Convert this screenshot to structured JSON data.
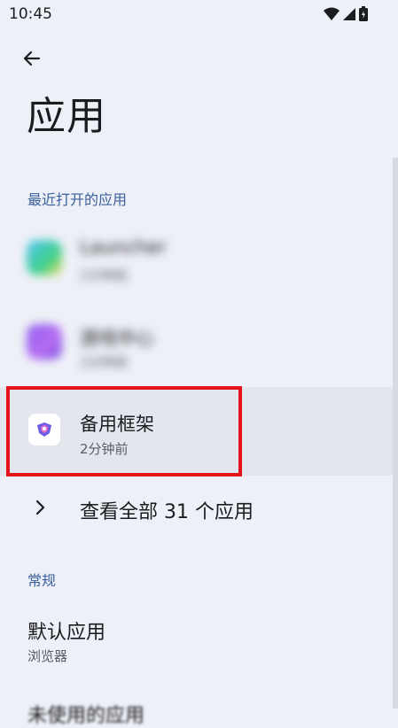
{
  "status_bar": {
    "time": "10:45"
  },
  "header": {
    "title": "应用"
  },
  "recent_section": {
    "header": "最近打开的应用",
    "apps": [
      {
        "name": "Launcher",
        "sub": "2分钟前",
        "blurred": true
      },
      {
        "name": "游戏中心",
        "sub": "2分钟前",
        "blurred": true
      },
      {
        "name": "备用框架",
        "sub": "2分钟前",
        "blurred": false
      }
    ],
    "see_all": "查看全部 31 个应用"
  },
  "general_section": {
    "header": "常规",
    "default_apps": {
      "title": "默认应用",
      "sub": "浏览器"
    },
    "next_item": "未使用的应用"
  },
  "colors": {
    "background": "#eef0f7",
    "accent": "#3a5f9e",
    "highlight_border": "#e4121b"
  }
}
